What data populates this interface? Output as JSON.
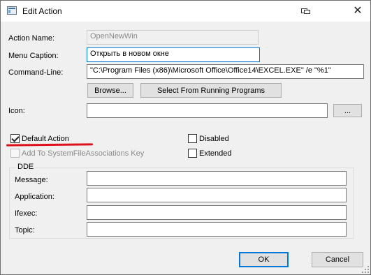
{
  "window": {
    "title": "Edit Action"
  },
  "form": {
    "action_name": {
      "label": "Action Name:",
      "value": "OpenNewWin"
    },
    "menu_caption": {
      "label": "Menu Caption:",
      "value": "Открыть в новом окне"
    },
    "command_line": {
      "label": "Command-Line:",
      "value": "\"C:\\Program Files (x86)\\Microsoft Office\\Office14\\EXCEL.EXE\" /e \"%1\""
    },
    "browse_label": "Browse...",
    "select_running_label": "Select From Running Programs",
    "icon": {
      "label": "Icon:",
      "value": ""
    },
    "icon_browse_label": "..."
  },
  "options": {
    "default_action": {
      "label": "Default Action",
      "checked": true
    },
    "add_to_sfa": {
      "label": "Add To SystemFileAssociations Key",
      "checked": false,
      "disabled": true
    },
    "disabled": {
      "label": "Disabled",
      "checked": false
    },
    "extended": {
      "label": "Extended",
      "checked": false
    }
  },
  "dde": {
    "title": "DDE",
    "message": {
      "label": "Message:",
      "value": ""
    },
    "application": {
      "label": "Application:",
      "value": ""
    },
    "ifexec": {
      "label": "Ifexec:",
      "value": ""
    },
    "topic": {
      "label": "Topic:",
      "value": ""
    }
  },
  "buttons": {
    "ok": "OK",
    "cancel": "Cancel"
  },
  "colors": {
    "focus_accent": "#0078d7",
    "annotation_mark": "#e0101a"
  },
  "icons": {
    "app": "app-window-icon",
    "restore": "restore-icon",
    "close": "close-icon",
    "check": "checkmark-icon"
  }
}
